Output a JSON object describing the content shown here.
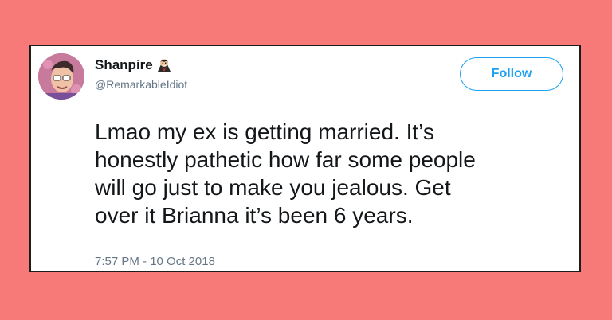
{
  "tweet": {
    "display_name": "Shanpire",
    "name_emoji_icon": "vampire-emoji-icon",
    "handle": "@RemarkableIdiot",
    "follow_label": "Follow",
    "lines": [
      "Lmao my ex is getting married. It’s",
      "honestly pathetic how far some people",
      "will go just to make you jealous. Get",
      "over it Brianna it’s been 6 years."
    ],
    "timestamp": "7:57 PM - 10 Oct 2018"
  },
  "colors": {
    "background": "#f77a78",
    "accent": "#1da1f2",
    "text": "#14171a",
    "muted": "#657786"
  }
}
